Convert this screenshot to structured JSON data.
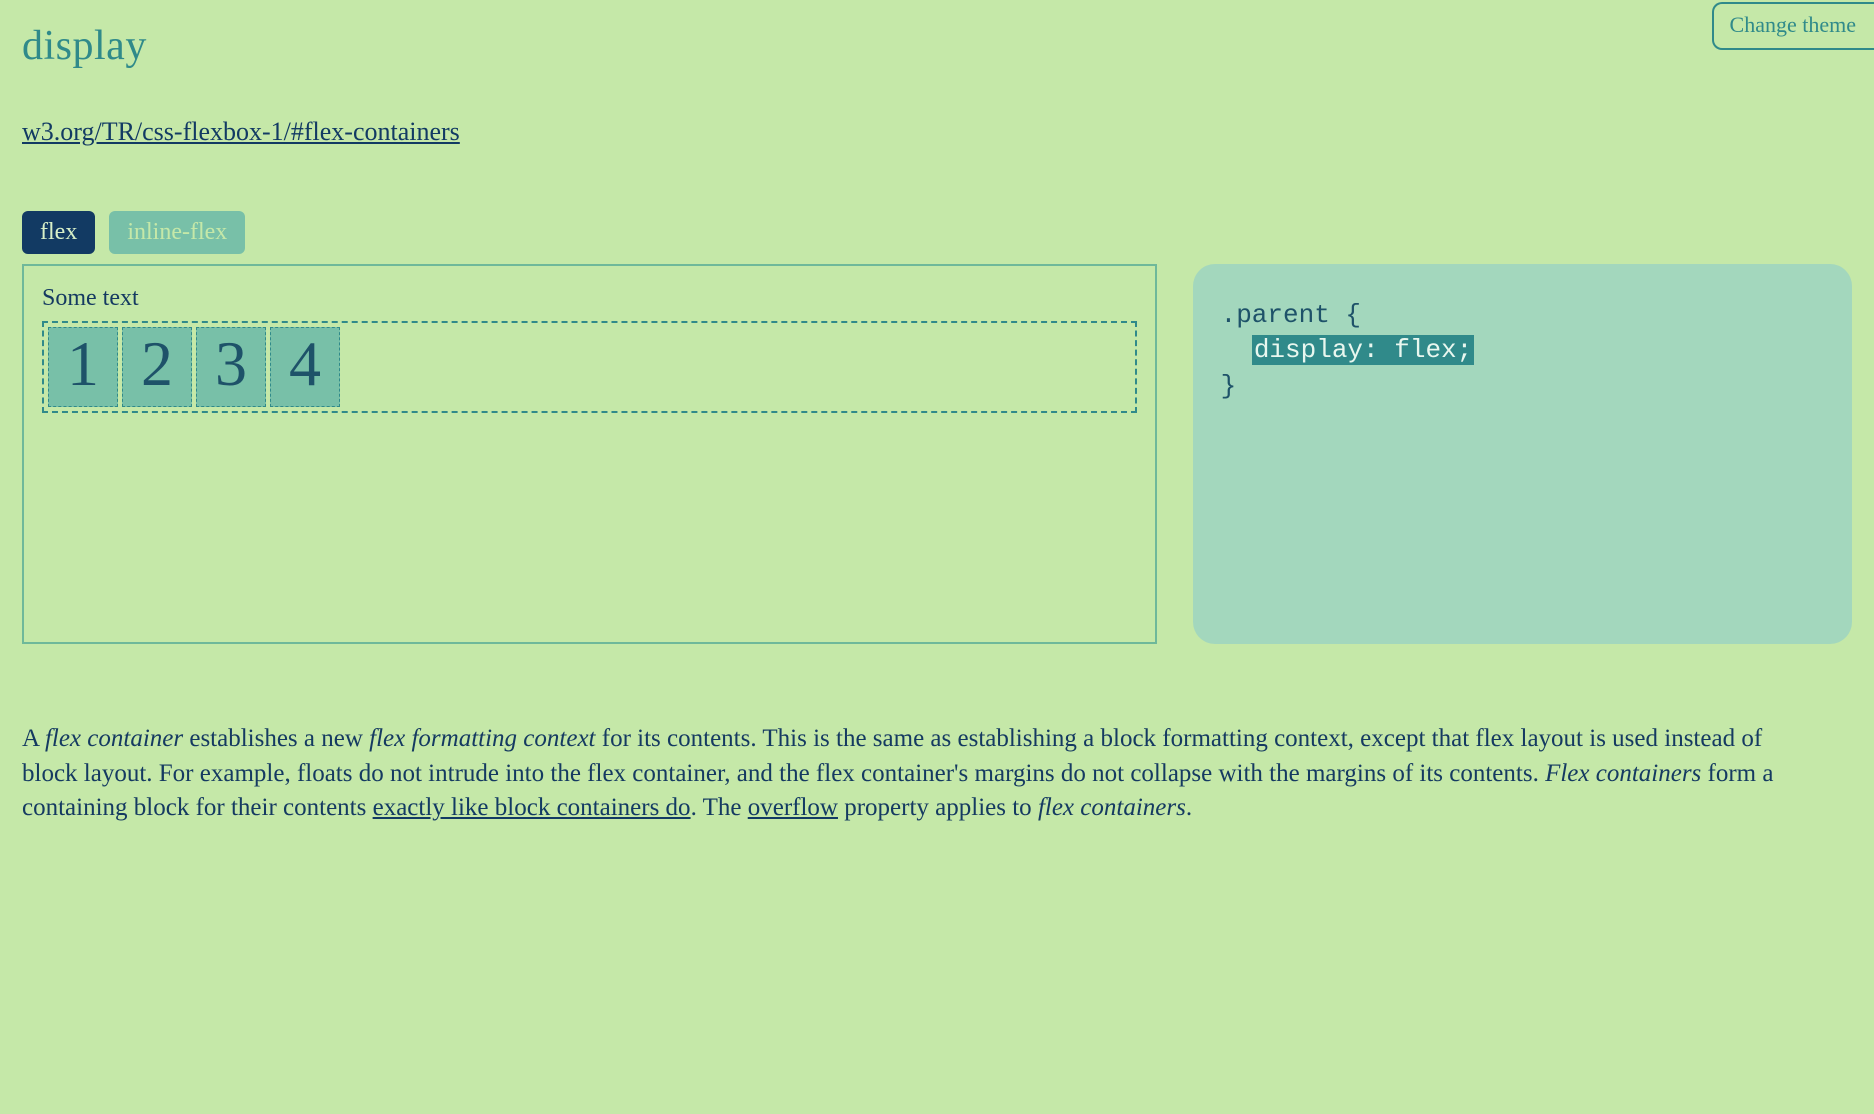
{
  "page": {
    "title": "display",
    "theme_button": "Change theme",
    "spec_link_text": "w3.org/TR/css-flexbox-1/#flex-containers"
  },
  "tabs": [
    {
      "label": "flex",
      "active": true
    },
    {
      "label": "inline-flex",
      "active": false
    }
  ],
  "demo": {
    "preamble": "Some text",
    "items": [
      "1",
      "2",
      "3",
      "4"
    ]
  },
  "code": {
    "selector": ".parent",
    "open_brace": "{",
    "rule": "display: flex;",
    "close_brace": "}"
  },
  "description": {
    "t0": "A ",
    "em0": "flex container",
    "t1": " establishes a new ",
    "em1": "flex formatting context",
    "t2": " for its contents. This is the same as establishing a block formatting context, except that flex layout is used instead of block layout. For example, floats do not intrude into the flex container, and the flex container's margins do not collapse with the margins of its contents. ",
    "em2": "Flex containers",
    "t3": " form a containing block for their contents ",
    "link0": "exactly like block containers do",
    "t4": ". The ",
    "link1": "overflow",
    "t5": " property applies to ",
    "em3": "flex containers",
    "t6": "."
  }
}
